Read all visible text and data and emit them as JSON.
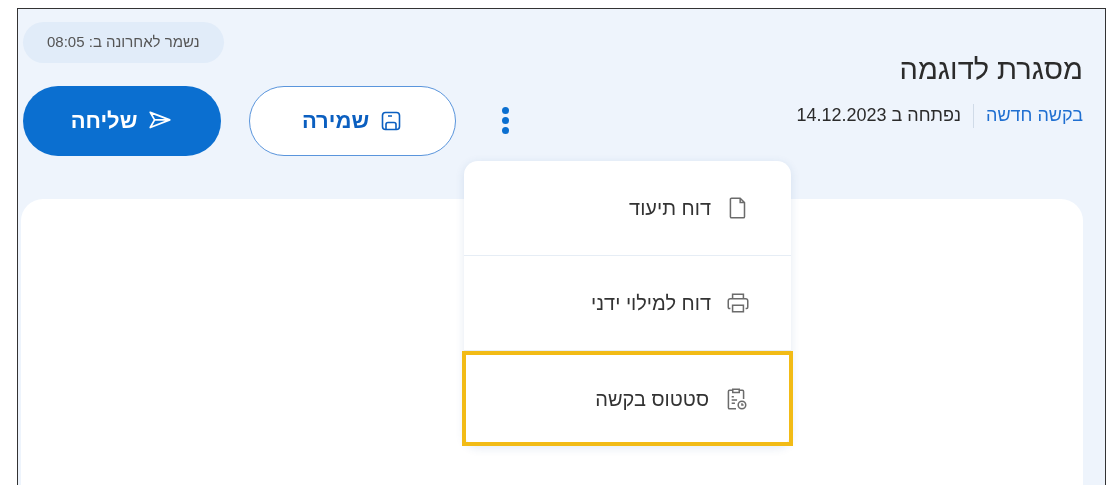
{
  "header": {
    "title": "מסגרת לדוגמה",
    "link": "בקשה חדשה",
    "opened": "נפתחה ב 14.12.2023"
  },
  "saved_badge": "נשמר לאחרונה ב: 08:05",
  "buttons": [
    {
      "kind": "outline",
      "label": "שמירה"
    },
    {
      "kind": "primary",
      "label": "שליחה"
    }
  ],
  "menu": {
    "expanded": true,
    "items": [
      {
        "kind": "document",
        "label": "דוח תיעוד",
        "highlighted": false
      },
      {
        "kind": "printer",
        "label": "דוח למילוי ידני",
        "highlighted": false
      },
      {
        "kind": "status",
        "label": "סטטוס בקשה",
        "highlighted": true
      }
    ]
  }
}
